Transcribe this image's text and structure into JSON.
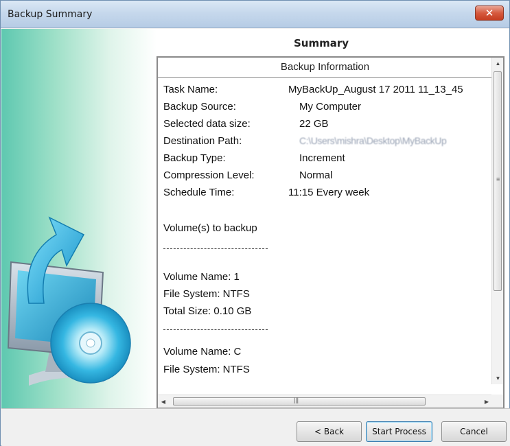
{
  "window": {
    "title": "Backup Summary",
    "close_symbol": "✕"
  },
  "summary": {
    "heading": "Summary"
  },
  "backup_info": {
    "header": "Backup Information",
    "fields": [
      {
        "label": "Task Name:",
        "value": "MyBackUp_August 17 2011 11_13_45"
      },
      {
        "label": "Backup Source:",
        "value": "My Computer"
      },
      {
        "label": "Selected data size:",
        "value": "22 GB"
      },
      {
        "label": "Destination Path:",
        "value": "C:\\Users\\mishra\\Desktop\\MyBackUp"
      },
      {
        "label": "Backup Type:",
        "value": "Increment"
      },
      {
        "label": "Compression Level:",
        "value": "Normal"
      },
      {
        "label": "Schedule Time:",
        "value": "11:15  Every week"
      }
    ],
    "volumes_heading": "Volume(s) to backup",
    "volume1": {
      "name": "Volume Name: 1",
      "fs": "File System: NTFS",
      "size": "Total Size: 0.10 GB"
    },
    "volume2": {
      "name": "Volume Name: C",
      "fs": "File System: NTFS"
    }
  },
  "buttons": {
    "back": "< Back",
    "start": "Start Process",
    "cancel": "Cancel"
  },
  "colors": {
    "accent_teal": "#2fb5d8",
    "close_red": "#c53d20"
  }
}
